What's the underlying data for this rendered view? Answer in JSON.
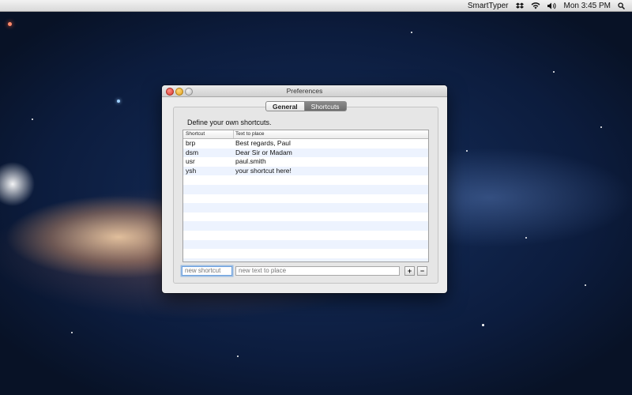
{
  "menubar": {
    "app_name": "SmartTyper",
    "clock": "Mon 3:45 PM",
    "icons": [
      "dropbox-icon",
      "wifi-icon",
      "volume-icon",
      "spotlight-search-icon"
    ]
  },
  "window": {
    "title": "Preferences",
    "tabs": [
      {
        "label": "General",
        "selected": false
      },
      {
        "label": "Shortcuts",
        "selected": true
      }
    ],
    "heading": "Define your own shortcuts.",
    "table": {
      "columns": [
        "Shortcut",
        "Text to place"
      ],
      "rows": [
        {
          "shortcut": "brp",
          "text": "Best regards, Paul"
        },
        {
          "shortcut": "dsm",
          "text": "Dear Sir or Madam"
        },
        {
          "shortcut": "usr",
          "text": "paul.smith"
        },
        {
          "shortcut": "ysh",
          "text": "your shortcut here!"
        }
      ]
    },
    "inputs": {
      "shortcut_placeholder": "new shortcut",
      "text_placeholder": "new text to place"
    },
    "buttons": {
      "add": "+",
      "remove": "−"
    }
  }
}
